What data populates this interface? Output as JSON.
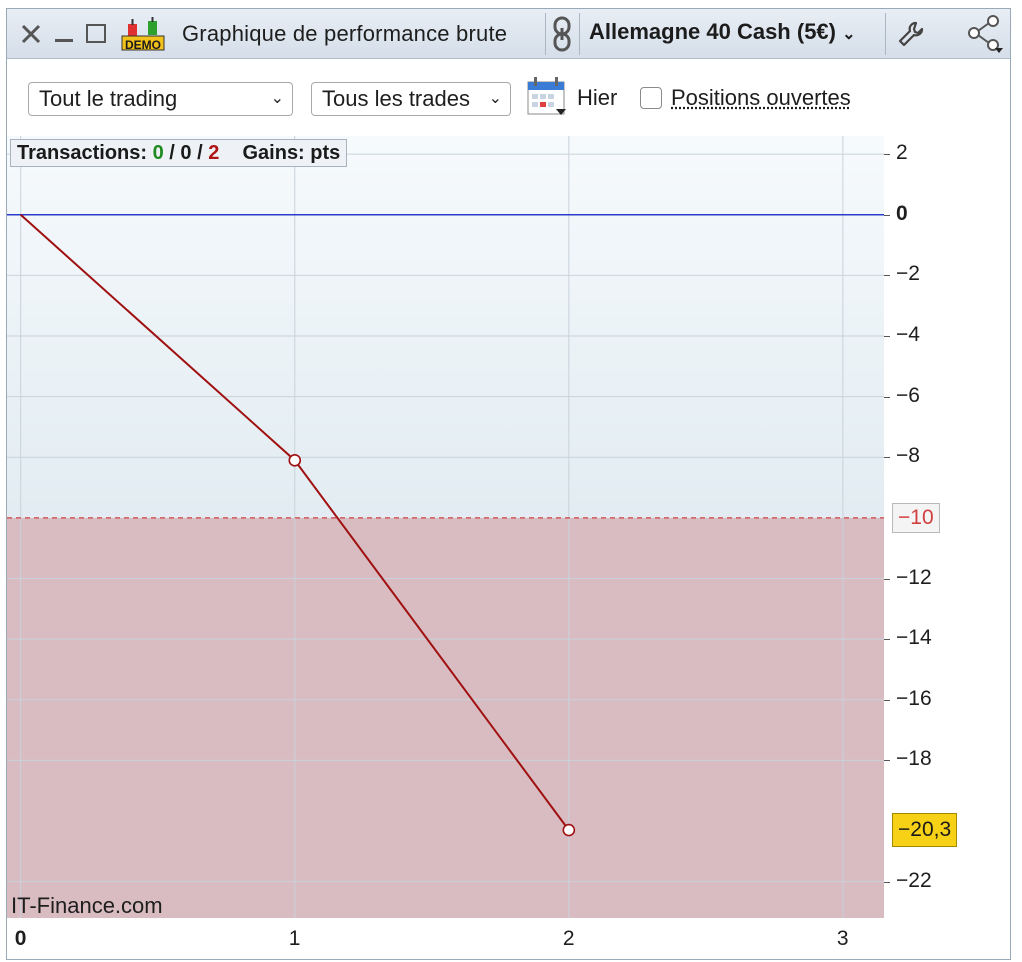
{
  "window": {
    "title": "Graphique de performance brute",
    "demo_badge": "DEMO",
    "instrument": "Allemagne 40 Cash (5€)",
    "icons": [
      "close-icon",
      "minimize-icon",
      "maximize-icon",
      "demo-candlestick-icon",
      "link-icon",
      "wrench-icon",
      "share-icon"
    ]
  },
  "toolbar": {
    "scope_select": "Tout le trading",
    "trades_select": "Tous les trades",
    "date_label": "Hier",
    "open_positions_label": "Positions ouvertes",
    "open_positions_checked": false
  },
  "info": {
    "transactions_label": "Transactions:",
    "winners": "0",
    "separator": "/",
    "neutral": "0",
    "losers": "2",
    "gains_label": "Gains:",
    "gains_unit": "pts"
  },
  "watermark": "IT-Finance.com",
  "chart_data": {
    "type": "line",
    "x": [
      0,
      1,
      2
    ],
    "values": [
      0,
      -8.1,
      -20.3
    ],
    "xlim": [
      -0.05,
      3.15
    ],
    "ylim": [
      -23.2,
      2.6
    ],
    "x_ticks": [
      "0",
      "1",
      "2",
      "3"
    ],
    "y_ticks": [
      "2",
      "0",
      "−2",
      "−4",
      "−6",
      "−8",
      "−12",
      "−14",
      "−16",
      "−18",
      "−22"
    ],
    "threshold": {
      "value": -10,
      "label": "−10"
    },
    "last_value": {
      "value": -20.3,
      "label": "−20,3"
    },
    "grid": true,
    "colors": {
      "line": "#a01010",
      "zero_line": "#2a3cc8",
      "threshold": "#d04040",
      "below_fill": "#d8bcc2",
      "above_fill": "#eef4f8",
      "last_badge": "#f7d116"
    }
  }
}
